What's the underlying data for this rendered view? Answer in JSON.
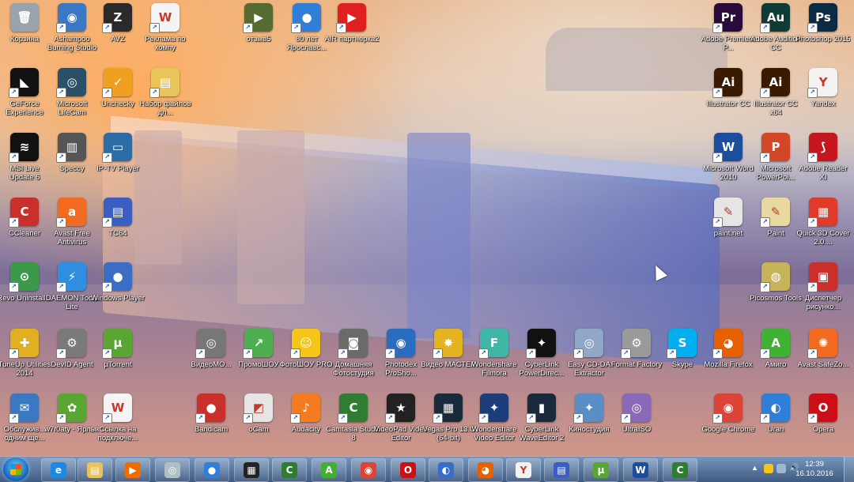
{
  "desktop": {
    "icons": [
      {
        "label": "Корзина",
        "icon": "recycle-bin-icon",
        "color": "#9aa3ad",
        "glyph": "🗑"
      },
      {
        "label": "Ashampoo Burning Studio 2017",
        "icon": "ashampoo-burning-icon",
        "color": "#3a78c4",
        "glyph": "◉"
      },
      {
        "label": "AVZ",
        "icon": "avz-icon",
        "color": "#2a2a2a",
        "glyph": "Z"
      },
      {
        "label": "Реклама по компу",
        "icon": "word-document-icon",
        "color": "#f4f4f4",
        "glyph": "W"
      },
      {
        "label": "отзыв5",
        "icon": "video-file-icon",
        "color": "#556b2f",
        "glyph": "▶"
      },
      {
        "label": "80 лет Ярославс...",
        "icon": "media-player-icon",
        "color": "#2f7ed8",
        "glyph": "●"
      },
      {
        "label": "AIR партнерка2",
        "icon": "youtube-icon",
        "color": "#e02020",
        "glyph": "▶"
      },
      {
        "label": "Adobe Premiere P...",
        "icon": "premiere-icon",
        "color": "#2a0a3a",
        "glyph": "Pr"
      },
      {
        "label": "Adobe Audition CC",
        "icon": "audition-icon",
        "color": "#0e3b36",
        "glyph": "Au"
      },
      {
        "label": "Photoshop 2015",
        "icon": "photoshop-icon",
        "color": "#0b2a44",
        "glyph": "Ps"
      },
      {
        "label": "GeForce Experience",
        "icon": "geforce-icon",
        "color": "#111",
        "glyph": "◣"
      },
      {
        "label": "Microsoft LifeCam",
        "icon": "lifecam-icon",
        "color": "#2b4f66",
        "glyph": "◎"
      },
      {
        "label": "Unchecky",
        "icon": "unchecky-icon",
        "color": "#f0a020",
        "glyph": "✓"
      },
      {
        "label": "Набор файлов дл...",
        "icon": "folder-icon",
        "color": "#e8c45a",
        "glyph": "▤"
      },
      {
        "label": "Illustrator CC",
        "icon": "illustrator-icon",
        "color": "#3a1a00",
        "glyph": "Ai"
      },
      {
        "label": "Illustrator CC x64",
        "icon": "illustrator-x64-icon",
        "color": "#3a1a00",
        "glyph": "Ai"
      },
      {
        "label": "Yandex",
        "icon": "yandex-icon",
        "color": "#f2f2f2",
        "glyph": "Y"
      },
      {
        "label": "MSI Live Update 6",
        "icon": "msi-live-icon",
        "color": "#111",
        "glyph": "≋"
      },
      {
        "label": "Speccy",
        "icon": "speccy-icon",
        "color": "#555",
        "glyph": "▥"
      },
      {
        "label": "IP-TV Player",
        "icon": "iptv-icon",
        "color": "#2c6da8",
        "glyph": "▭"
      },
      {
        "label": "Microsoft Word 2010",
        "icon": "word-icon",
        "color": "#1d4e9e",
        "glyph": "W"
      },
      {
        "label": "Microsoft PowerPoi...",
        "icon": "powerpoint-icon",
        "color": "#d24726",
        "glyph": "P"
      },
      {
        "label": "Adobe Reader XI",
        "icon": "adobe-reader-icon",
        "color": "#c4161c",
        "glyph": "⟆"
      },
      {
        "label": "CCleaner",
        "icon": "ccleaner-icon",
        "color": "#c9302c",
        "glyph": "C"
      },
      {
        "label": "Avast Free Antivirus",
        "icon": "avast-icon",
        "color": "#f26b21",
        "glyph": "a"
      },
      {
        "label": "TC64",
        "icon": "totalcommander-icon",
        "color": "#3b5fc0",
        "glyph": "▤"
      },
      {
        "label": "paint.net",
        "icon": "paintnet-icon",
        "color": "#e5e5e5",
        "glyph": "✎"
      },
      {
        "label": "Paint",
        "icon": "paint-icon",
        "color": "#e8d9a0",
        "glyph": "✎"
      },
      {
        "label": "Quick 3D Cover 2.0....",
        "icon": "quick3dcover-icon",
        "color": "#e03a2a",
        "glyph": "▦"
      },
      {
        "label": "Revo Uninstall...",
        "icon": "revo-uninstaller-icon",
        "color": "#3a9a4a",
        "glyph": "⊙"
      },
      {
        "label": "DAEMON Tools Lite",
        "icon": "daemon-tools-icon",
        "color": "#2f8ee0",
        "glyph": "⚡"
      },
      {
        "label": "Windows Player",
        "icon": "windows-player-icon",
        "color": "#3a6ec6",
        "glyph": "●"
      },
      {
        "label": "Picosmos Tools",
        "icon": "picosmos-icon",
        "color": "#c7b35a",
        "glyph": "◍"
      },
      {
        "label": "Диспетчер рисунко...",
        "icon": "picture-manager-icon",
        "color": "#c9302c",
        "glyph": "▣"
      },
      {
        "label": "TuneUp Utilities 2014",
        "icon": "tuneup-icon",
        "color": "#e0b020",
        "glyph": "✚"
      },
      {
        "label": "DevID Agent",
        "icon": "devid-agent-icon",
        "color": "#7a7a7a",
        "glyph": "⚙"
      },
      {
        "label": "µTorrent",
        "icon": "utorrent-icon",
        "color": "#5aa632",
        "glyph": "µ"
      },
      {
        "label": "ВидеоМО...",
        "icon": "video-montage-icon",
        "color": "#777",
        "glyph": "◎"
      },
      {
        "label": "ПромоШОУ",
        "icon": "promoshow-icon",
        "color": "#4caf50",
        "glyph": "↗"
      },
      {
        "label": "ФотоШОУ PRO",
        "icon": "fotoshow-icon",
        "color": "#f5c518",
        "glyph": "☺"
      },
      {
        "label": "Домашняя Фотостудия",
        "icon": "home-photostudio-icon",
        "color": "#6a6a6a",
        "glyph": "◙"
      },
      {
        "label": "Photodex ProSho...",
        "icon": "photodex-icon",
        "color": "#2a6cbf",
        "glyph": "◉"
      },
      {
        "label": "Видео МАСТЕР",
        "icon": "video-master-icon",
        "color": "#e3b321",
        "glyph": "✸"
      },
      {
        "label": "Wondershare Filmora",
        "icon": "filmora-icon",
        "color": "#3fb6a8",
        "glyph": "F"
      },
      {
        "label": "CyberLink PowerDirec...",
        "icon": "powerdirector-icon",
        "color": "#111",
        "glyph": "✦"
      },
      {
        "label": "Easy CD-DA Extractor",
        "icon": "easy-cdda-icon",
        "color": "#8fa8c8",
        "glyph": "◎"
      },
      {
        "label": "Format Factory",
        "icon": "format-factory-icon",
        "color": "#9a9a9a",
        "glyph": "⚙"
      },
      {
        "label": "Skype",
        "icon": "skype-icon",
        "color": "#00aff0",
        "glyph": "S"
      },
      {
        "label": "Mozilla Firefox",
        "icon": "firefox-icon",
        "color": "#e66000",
        "glyph": "◕"
      },
      {
        "label": "Амиго",
        "icon": "amigo-icon",
        "color": "#3fb233",
        "glyph": "A"
      },
      {
        "label": "Avast SafeZo...",
        "icon": "avast-safezone-icon",
        "color": "#f26b21",
        "glyph": "✺"
      },
      {
        "label": "Обслужив... одним ще...",
        "icon": "maintenance-icon",
        "color": "#3a78c4",
        "glyph": "✉"
      },
      {
        "label": "w7f0aty - Ярлык",
        "icon": "green-shortcut-icon",
        "color": "#5aa632",
        "glyph": "✿"
      },
      {
        "label": "Ссылка на подключе...",
        "icon": "word-document-icon",
        "color": "#f4f4f4",
        "glyph": "W"
      },
      {
        "label": "Bandicam",
        "icon": "bandicam-icon",
        "color": "#c9302c",
        "glyph": "●"
      },
      {
        "label": "oCam",
        "icon": "ocam-icon",
        "color": "#e5e5e5",
        "glyph": "◩"
      },
      {
        "label": "Audacity",
        "icon": "audacity-icon",
        "color": "#f47b20",
        "glyph": "♪"
      },
      {
        "label": "Camtasia Studio 8",
        "icon": "camtasia-icon",
        "color": "#2e7d32",
        "glyph": "C"
      },
      {
        "label": "VideoPad Video Editor",
        "icon": "videopad-icon",
        "color": "#222",
        "glyph": "★"
      },
      {
        "label": "Vegas Pro 13.0 (64-bit)",
        "icon": "vegas-pro-icon",
        "color": "#1a2a3a",
        "glyph": "▦"
      },
      {
        "label": "Wondershare Video Editor",
        "icon": "wondershare-editor-icon",
        "color": "#1d3d7a",
        "glyph": "✦"
      },
      {
        "label": "CyberLink WaveEditor 2",
        "icon": "waveeditor-icon",
        "color": "#1a2a3a",
        "glyph": "▮"
      },
      {
        "label": "Киностудия",
        "icon": "movie-maker-icon",
        "color": "#5a8ec6",
        "glyph": "✦"
      },
      {
        "label": "UltraISO",
        "icon": "ultraiso-icon",
        "color": "#8a6ab8",
        "glyph": "◎"
      },
      {
        "label": "Google Chrome",
        "icon": "chrome-icon",
        "color": "#db4437",
        "glyph": "◉"
      },
      {
        "label": "Uran",
        "icon": "uran-icon",
        "color": "#2f7ed8",
        "glyph": "◐"
      },
      {
        "label": "Opera",
        "icon": "opera-icon",
        "color": "#cc0f16",
        "glyph": "O"
      }
    ]
  },
  "taskbar": {
    "items": [
      {
        "name": "internet-explorer",
        "icon": "internet-explorer-icon",
        "color": "#1e88e5",
        "glyph": "e"
      },
      {
        "name": "windows-explorer",
        "icon": "folder-icon",
        "color": "#e8c45a",
        "glyph": "▤"
      },
      {
        "name": "media-player",
        "icon": "media-player-icon",
        "color": "#ef6c00",
        "glyph": "▶"
      },
      {
        "name": "cd-burner",
        "icon": "disc-icon",
        "color": "#b0bec5",
        "glyph": "◎"
      },
      {
        "name": "globe",
        "icon": "globe-icon",
        "color": "#2f7ed8",
        "glyph": "●"
      },
      {
        "name": "film-strip",
        "icon": "film-icon",
        "color": "#222",
        "glyph": "▦"
      },
      {
        "name": "camtasia",
        "icon": "camtasia-icon",
        "color": "#2e7d32",
        "glyph": "C"
      },
      {
        "name": "amigo",
        "icon": "amigo-icon",
        "color": "#3fb233",
        "glyph": "A"
      },
      {
        "name": "chrome",
        "icon": "chrome-icon",
        "color": "#db4437",
        "glyph": "◉"
      },
      {
        "name": "opera",
        "icon": "opera-icon",
        "color": "#cc0f16",
        "glyph": "O"
      },
      {
        "name": "network-globe",
        "icon": "network-icon",
        "color": "#3a6ec6",
        "glyph": "◐"
      },
      {
        "name": "firefox",
        "icon": "firefox-icon",
        "color": "#e66000",
        "glyph": "◕"
      },
      {
        "name": "yandex",
        "icon": "yandex-icon",
        "color": "#f2f2f2",
        "glyph": "Y"
      },
      {
        "name": "floppy",
        "icon": "save-icon",
        "color": "#3b5fc0",
        "glyph": "▤"
      },
      {
        "name": "utorrent",
        "icon": "utorrent-icon",
        "color": "#5aa632",
        "glyph": "µ"
      },
      {
        "name": "word",
        "icon": "word-icon",
        "color": "#1d4e9e",
        "glyph": "W"
      },
      {
        "name": "camtasia-recorder",
        "icon": "camtasia-recorder-icon",
        "color": "#2e7d32",
        "glyph": "C"
      }
    ],
    "clock": {
      "time": "12:39",
      "date": "16.10.2016"
    }
  }
}
